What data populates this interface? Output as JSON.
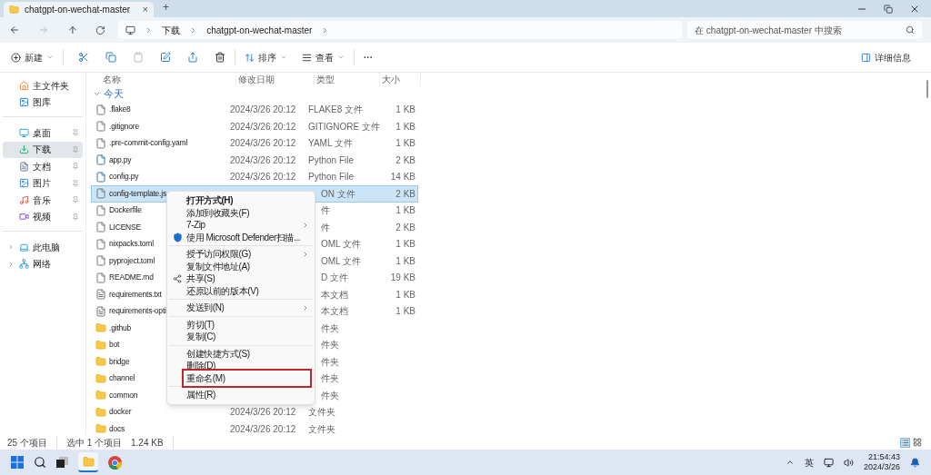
{
  "tab": {
    "title": "chatgpt-on-wechat-master",
    "close": "×",
    "new": "+"
  },
  "address": {
    "crumbs": [
      "下载",
      "chatgpt-on-wechat-master"
    ],
    "search_placeholder": "在 chatgpt-on-wechat-master 中搜索"
  },
  "toolbar": {
    "new": "新建",
    "sort": "排序",
    "view": "查看",
    "more": "···",
    "details": "详细信息"
  },
  "sidebar": {
    "groups": [
      [
        {
          "label": "主文件夹",
          "kind": "home",
          "selected": false,
          "pinned": false
        },
        {
          "label": "图库",
          "kind": "gallery",
          "selected": false,
          "pinned": false
        }
      ],
      [
        {
          "label": "桌面",
          "kind": "desktop",
          "selected": false,
          "pinned": true
        },
        {
          "label": "下载",
          "kind": "download",
          "selected": true,
          "pinned": true
        },
        {
          "label": "文档",
          "kind": "document",
          "selected": false,
          "pinned": true
        },
        {
          "label": "图片",
          "kind": "picture",
          "selected": false,
          "pinned": true
        },
        {
          "label": "音乐",
          "kind": "music",
          "selected": false,
          "pinned": true
        },
        {
          "label": "视频",
          "kind": "video",
          "selected": false,
          "pinned": true
        }
      ],
      [
        {
          "label": "此电脑",
          "kind": "pc",
          "selected": false,
          "pinned": false
        },
        {
          "label": "网络",
          "kind": "network",
          "selected": false,
          "pinned": false
        }
      ]
    ]
  },
  "table": {
    "columns": [
      "名称",
      "修改日期",
      "类型",
      "大小"
    ],
    "group": "今天",
    "rows": [
      {
        "name": ".flake8",
        "kind": "file",
        "date": "2024/3/26 20:12",
        "type": "FLAKE8 文件",
        "size": "1 KB",
        "selected": false
      },
      {
        "name": ".gitignore",
        "kind": "file",
        "date": "2024/3/26 20:12",
        "type": "GITIGNORE 文件",
        "size": "1 KB",
        "selected": false
      },
      {
        "name": ".pre-commit-config.yaml",
        "kind": "file",
        "date": "2024/3/26 20:12",
        "type": "YAML 文件",
        "size": "1 KB",
        "selected": false
      },
      {
        "name": "app.py",
        "kind": "python",
        "date": "2024/3/26 20:12",
        "type": "Python File",
        "size": "2 KB",
        "selected": false
      },
      {
        "name": "config.py",
        "kind": "python",
        "date": "2024/3/26 20:12",
        "type": "Python File",
        "size": "14 KB",
        "selected": false
      },
      {
        "name": "config-template.js",
        "kind": "file",
        "type": "ON 文件",
        "size": "2 KB",
        "selected": true
      },
      {
        "name": "Dockerfile",
        "kind": "file",
        "type": "件",
        "size": "1 KB",
        "selected": false
      },
      {
        "name": "LICENSE",
        "kind": "file",
        "type": "件",
        "size": "2 KB",
        "selected": false
      },
      {
        "name": "nixpacks.toml",
        "kind": "file",
        "type": "OML 文件",
        "size": "1 KB",
        "selected": false
      },
      {
        "name": "pyproject.toml",
        "kind": "file",
        "type": "OML 文件",
        "size": "1 KB",
        "selected": false
      },
      {
        "name": "README.md",
        "kind": "file",
        "type": "D 文件",
        "size": "19 KB",
        "selected": false
      },
      {
        "name": "requirements.txt",
        "kind": "text",
        "type": "本文档",
        "size": "1 KB",
        "selected": false
      },
      {
        "name": "requirements-opti",
        "kind": "text",
        "type": "本文档",
        "size": "1 KB",
        "selected": false
      },
      {
        "name": ".github",
        "kind": "folder",
        "type": "件夹",
        "selected": false
      },
      {
        "name": "bot",
        "kind": "folder",
        "type": "件夹",
        "selected": false
      },
      {
        "name": "bridge",
        "kind": "folder",
        "type": "件夹",
        "selected": false
      },
      {
        "name": "channel",
        "kind": "folder",
        "type": "件夹",
        "selected": false
      },
      {
        "name": "common",
        "kind": "folder",
        "type": "件夹",
        "selected": false
      },
      {
        "name": "docker",
        "kind": "folder",
        "date": "2024/3/26 20:12",
        "type": "文件夹",
        "selected": false
      },
      {
        "name": "docs",
        "kind": "folder",
        "date": "2024/3/26 20:12",
        "type": "文件夹",
        "selected": false
      }
    ]
  },
  "menu": {
    "items": [
      {
        "kind": "item",
        "label": "打开方式(H)",
        "bold": true
      },
      {
        "kind": "item",
        "label": "添加到收藏夹(F)"
      },
      {
        "kind": "item",
        "label": "7-Zip",
        "submenu": true
      },
      {
        "kind": "defender",
        "label": "使用 Microsoft Defender扫描..."
      },
      {
        "kind": "separator"
      },
      {
        "kind": "item",
        "label": "授予访问权限(G)",
        "submenu": true
      },
      {
        "kind": "item",
        "label": "复制文件地址(A)"
      },
      {
        "kind": "share",
        "label": "共享(S)"
      },
      {
        "kind": "item",
        "label": "还原以前的版本(V)"
      },
      {
        "kind": "separator"
      },
      {
        "kind": "item",
        "label": "发送到(N)",
        "submenu": true
      },
      {
        "kind": "separator"
      },
      {
        "kind": "item",
        "label": "剪切(T)"
      },
      {
        "kind": "item",
        "label": "复制(C)"
      },
      {
        "kind": "separator"
      },
      {
        "kind": "item",
        "label": "创建快捷方式(S)"
      },
      {
        "kind": "item",
        "label": "删除(D)"
      },
      {
        "kind": "item",
        "label": "重命名(M)",
        "outlined": true
      },
      {
        "kind": "separator"
      },
      {
        "kind": "item",
        "label": "属性(R)"
      }
    ]
  },
  "status": {
    "count": "25 个项目",
    "selection": "选中 1 个项目",
    "size": "1.24 KB"
  },
  "tray": {
    "lang": "英",
    "time": "21:54:43",
    "date": "2024/3/26"
  }
}
